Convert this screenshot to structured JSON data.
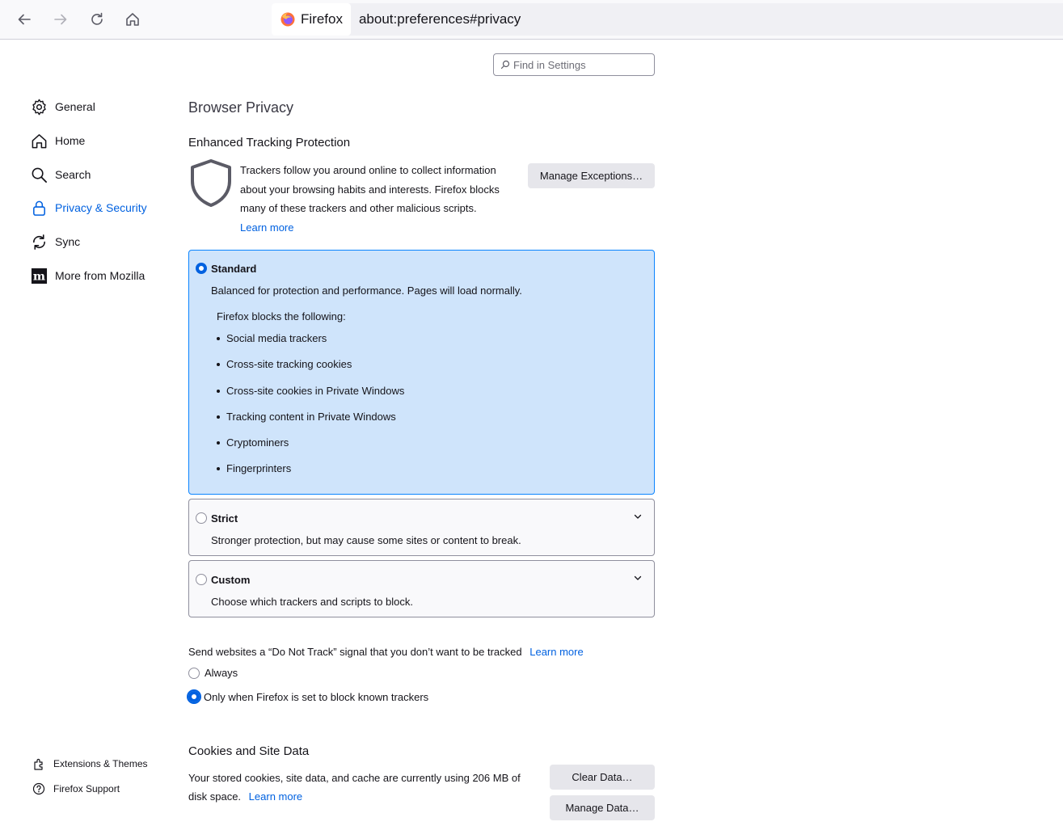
{
  "toolbar": {
    "identity_label": "Firefox",
    "url": "about:preferences#privacy"
  },
  "search": {
    "placeholder": "Find in Settings"
  },
  "sidebar": {
    "items": [
      {
        "label": "General",
        "icon": "gear-icon"
      },
      {
        "label": "Home",
        "icon": "home-icon"
      },
      {
        "label": "Search",
        "icon": "search-icon"
      },
      {
        "label": "Privacy & Security",
        "icon": "lock-icon",
        "selected": true
      },
      {
        "label": "Sync",
        "icon": "sync-icon"
      },
      {
        "label": "More from Mozilla",
        "icon": "mozilla-icon"
      }
    ],
    "footer": [
      {
        "label": "Extensions & Themes",
        "icon": "puzzle-icon"
      },
      {
        "label": "Firefox Support",
        "icon": "help-icon"
      }
    ]
  },
  "main": {
    "title": "Browser Privacy",
    "etp": {
      "heading": "Enhanced Tracking Protection",
      "description": "Trackers follow you around online to collect information about your browsing habits and interests. Firefox blocks many of these trackers and other malicious scripts.",
      "learn_more": "Learn more",
      "manage_exceptions": "Manage Exceptions…"
    },
    "options": {
      "standard": {
        "title": "Standard",
        "description": "Balanced for protection and performance. Pages will load normally.",
        "blocks_title": "Firefox blocks the following:",
        "blocks": [
          "Social media trackers",
          "Cross-site tracking cookies",
          "Cross-site cookies in Private Windows",
          "Tracking content in Private Windows",
          "Cryptominers",
          "Fingerprinters"
        ]
      },
      "strict": {
        "title": "Strict",
        "description": "Stronger protection, but may cause some sites or content to break."
      },
      "custom": {
        "title": "Custom",
        "description": "Choose which trackers and scripts to block."
      }
    },
    "dnt": {
      "text": "Send websites a “Do Not Track” signal that you don’t want to be tracked",
      "learn_more": "Learn more",
      "always": "Always",
      "only_when": "Only when Firefox is set to block known trackers"
    },
    "cookies": {
      "heading": "Cookies and Site Data",
      "description": "Your stored cookies, site data, and cache are currently using 206 MB of disk space.",
      "learn_more": "Learn more",
      "clear_data": "Clear Data…",
      "manage_data": "Manage Data…"
    }
  },
  "colors": {
    "accent": "#0061e0",
    "selected_card_bg": "#cfe4fb",
    "selected_card_border": "#0a84ff"
  }
}
